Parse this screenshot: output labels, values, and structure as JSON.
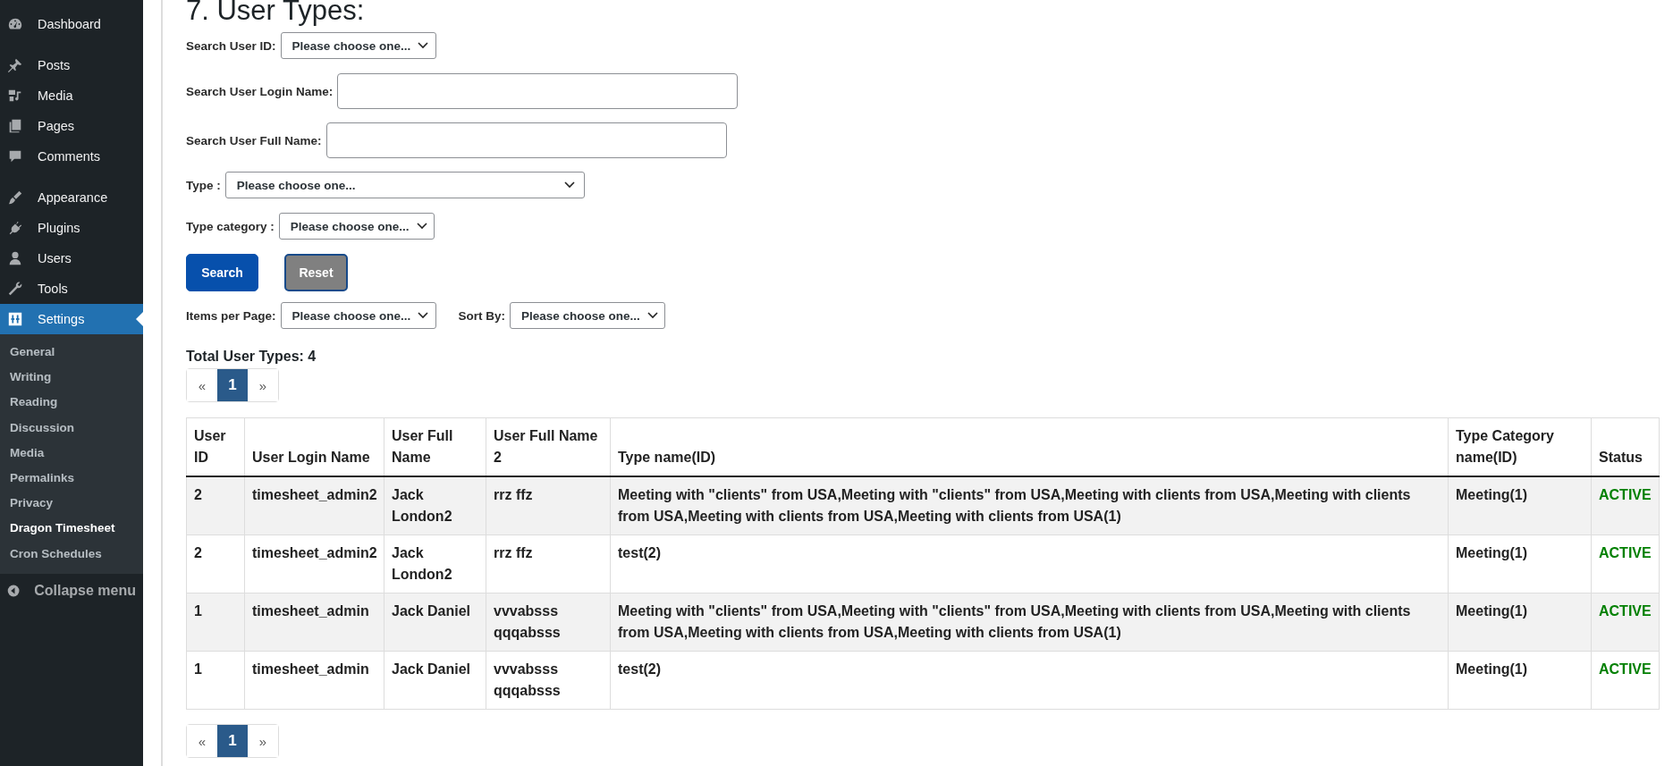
{
  "sidebar": {
    "menu": [
      {
        "label": "Dashboard",
        "selected": false
      },
      {
        "label": "Posts",
        "selected": false
      },
      {
        "label": "Media",
        "selected": false
      },
      {
        "label": "Pages",
        "selected": false
      },
      {
        "label": "Comments",
        "selected": false
      },
      {
        "label": "Appearance",
        "selected": false
      },
      {
        "label": "Plugins",
        "selected": false
      },
      {
        "label": "Users",
        "selected": false
      },
      {
        "label": "Tools",
        "selected": false
      },
      {
        "label": "Settings",
        "selected": true
      }
    ],
    "submenu": [
      {
        "label": "General",
        "selected": false
      },
      {
        "label": "Writing",
        "selected": false
      },
      {
        "label": "Reading",
        "selected": false
      },
      {
        "label": "Discussion",
        "selected": false
      },
      {
        "label": "Media",
        "selected": false
      },
      {
        "label": "Permalinks",
        "selected": false
      },
      {
        "label": "Privacy",
        "selected": false
      },
      {
        "label": "Dragon Timesheet",
        "selected": true
      },
      {
        "label": "Cron Schedules",
        "selected": false
      }
    ],
    "collapse": "Collapse menu"
  },
  "page": {
    "title": "7. User Types:",
    "filters": [
      {
        "kind": "select",
        "label": "Search User ID:",
        "value": "Please choose one..."
      },
      {
        "kind": "text",
        "label": "Search User Login Name:"
      },
      {
        "kind": "text",
        "label": "Search User Full Name:"
      },
      {
        "kind": "select",
        "label": "Type :",
        "value": "Please choose one..."
      },
      {
        "kind": "select",
        "label": "Type category :",
        "value": "Please choose one..."
      }
    ],
    "buttons": [
      {
        "label": "Search",
        "kind": "primary"
      },
      {
        "label": "Reset",
        "kind": "secondary"
      }
    ],
    "list_options": [
      {
        "label": "Items per Page:",
        "value": "Please choose one..."
      },
      {
        "label": "Sort By:",
        "value": "Please choose one..."
      }
    ],
    "total": "Total User Types: 4",
    "pagination_top": [
      {
        "label": "«",
        "selected": false
      },
      {
        "label": "1",
        "selected": true
      },
      {
        "label": "»",
        "selected": false
      }
    ],
    "table": {
      "columns": [
        "User ID",
        "User Login Name",
        "User Full Name",
        "User Full Name 2",
        "Type name(ID)",
        "Type Category name(ID)",
        "Status"
      ],
      "rows": [
        [
          "2",
          "timesheet_admin2",
          "Jack London2",
          "rrz ffz",
          "Meeting with \"clients\" from USA,Meeting with \"clients\" from USA,Meeting with clients from USA,Meeting with clients from USA,Meeting with clients from USA,Meeting with clients from USA(1)",
          "Meeting(1)",
          "ACTIVE"
        ],
        [
          "2",
          "timesheet_admin2",
          "Jack London2",
          "rrz ffz",
          "test(2)",
          "Meeting(1)",
          "ACTIVE"
        ],
        [
          "1",
          "timesheet_admin",
          "Jack Daniel",
          "vvvabsss qqqabsss",
          "Meeting with \"clients\" from USA,Meeting with \"clients\" from USA,Meeting with clients from USA,Meeting with clients from USA,Meeting with clients from USA,Meeting with clients from USA(1)",
          "Meeting(1)",
          "ACTIVE"
        ],
        [
          "1",
          "timesheet_admin",
          "Jack Daniel",
          "vvvabsss qqqabsss",
          "test(2)",
          "Meeting(1)",
          "ACTIVE"
        ]
      ]
    },
    "pagination_bottom": [
      {
        "label": "«",
        "selected": false
      },
      {
        "label": "1",
        "selected": true
      },
      {
        "label": "»",
        "selected": false
      }
    ]
  }
}
